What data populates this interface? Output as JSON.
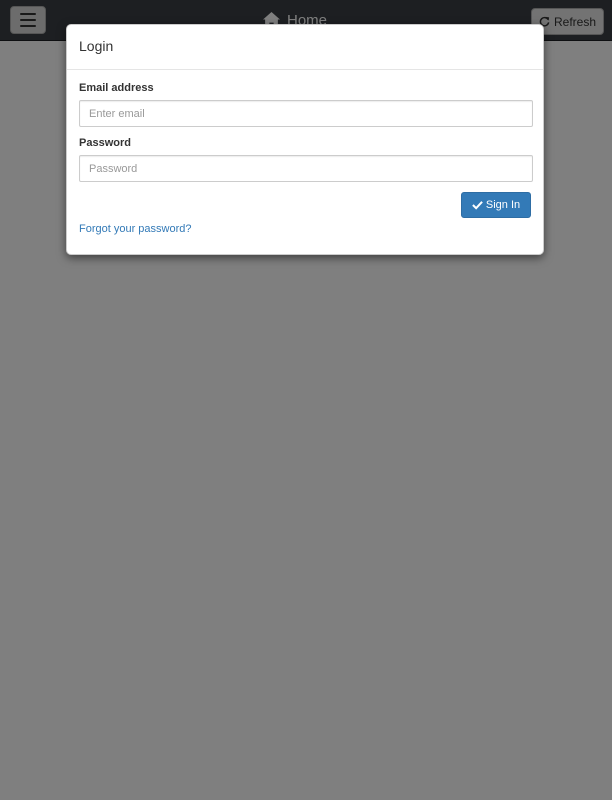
{
  "navbar": {
    "menu_icon": "hamburger-icon",
    "home_label": "Home",
    "home_icon": "home-icon",
    "refresh_label": "Refresh",
    "refresh_icon": "refresh-icon"
  },
  "modal": {
    "title": "Login",
    "email": {
      "label": "Email address",
      "placeholder": "Enter email",
      "value": ""
    },
    "password": {
      "label": "Password",
      "placeholder": "Password",
      "value": ""
    },
    "signin_label": "Sign In",
    "signin_icon": "checkmark-icon",
    "forgot_label": "Forgot your password?"
  },
  "colors": {
    "primary": "#337ab7",
    "navbar": "#3a3f44",
    "backdrop": "rgba(0,0,0,0.5)"
  }
}
